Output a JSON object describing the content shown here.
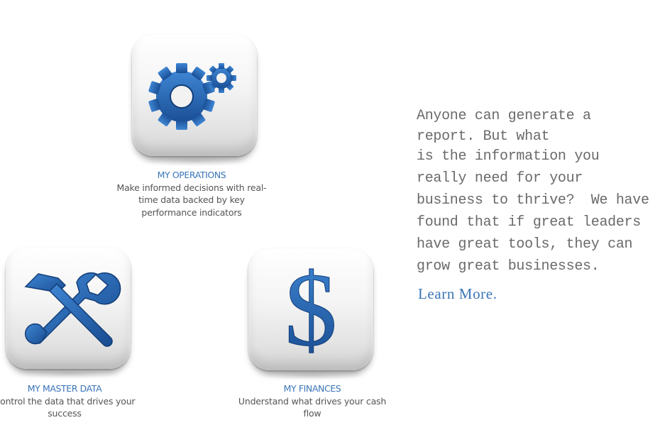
{
  "colors": {
    "accent_blue": "#3a75b8",
    "icon_blue": "#1f5fae",
    "body_text": "#555555",
    "copy_text": "#6a6a6a",
    "background": "#ffffff"
  },
  "features": [
    {
      "icon": "gears-icon",
      "title": "MY OPERATIONS",
      "description": "Make informed decisions with real-time data backed by key performance indicators"
    },
    {
      "icon": "tools-icon",
      "title": "MY MASTER DATA",
      "description": "Control the data that drives your success"
    },
    {
      "icon": "dollar-icon",
      "title": "MY FINANCES",
      "description": "Understand what drives your cash flow"
    }
  ],
  "copy": {
    "lines": [
      "Anyone can generate a",
      "report. But what",
      "is the information you",
      "really need for your",
      "business to thrive?  We have",
      "found that if great leaders",
      "have great tools, they can",
      "grow great businesses."
    ],
    "cta": "Learn More."
  }
}
